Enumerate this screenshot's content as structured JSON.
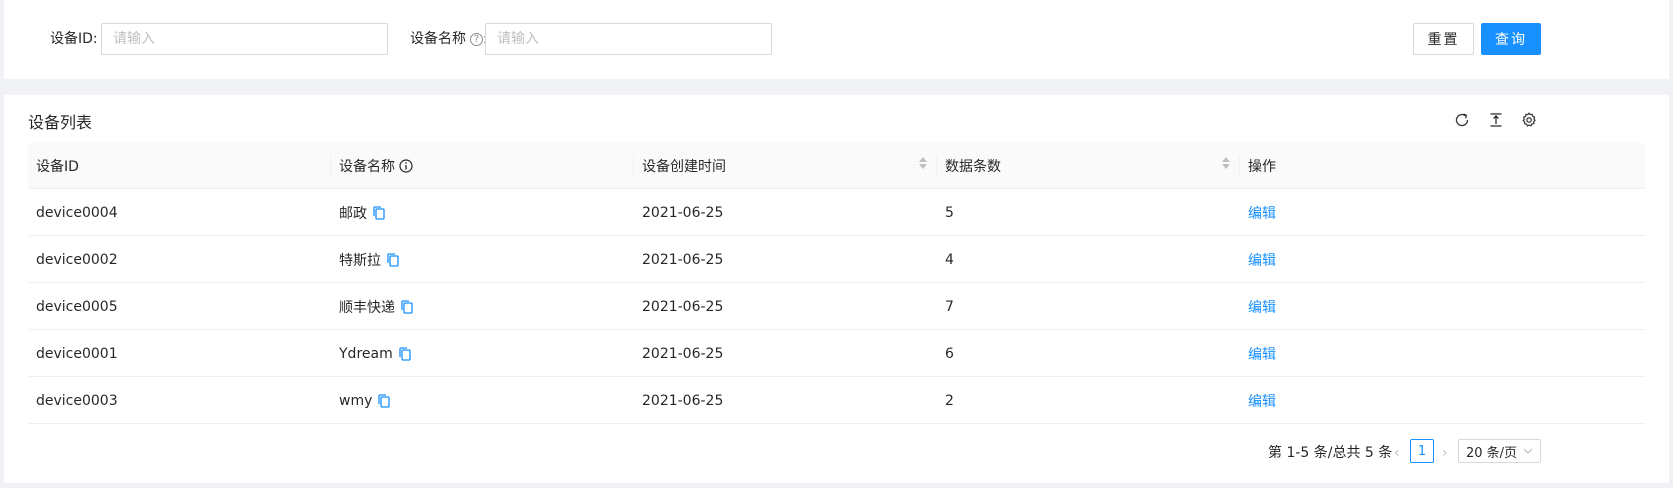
{
  "search": {
    "device_id_label": "设备ID:",
    "device_id_placeholder": "请输入",
    "device_name_label": "设备名称",
    "help_glyph": "?",
    "device_name_colon": ":",
    "device_name_placeholder": "请输入",
    "reset_label": "重置",
    "query_label": "查询"
  },
  "table": {
    "title": "设备列表",
    "columns": [
      "设备ID",
      "设备名称",
      "设备创建时间",
      "数据条数",
      "操作"
    ],
    "rows": [
      {
        "id": "device0004",
        "name": "邮政",
        "created": "2021-06-25",
        "count": "5",
        "action": "编辑"
      },
      {
        "id": "device0002",
        "name": "特斯拉",
        "created": "2021-06-25",
        "count": "4",
        "action": "编辑"
      },
      {
        "id": "device0005",
        "name": "顺丰快递",
        "created": "2021-06-25",
        "count": "7",
        "action": "编辑"
      },
      {
        "id": "device0001",
        "name": "Ydream",
        "created": "2021-06-25",
        "count": "6",
        "action": "编辑"
      },
      {
        "id": "device0003",
        "name": "wmy",
        "created": "2021-06-25",
        "count": "2",
        "action": "编辑"
      }
    ]
  },
  "pagination": {
    "total_text": "第 1-5 条/总共 5 条",
    "current_page": "1",
    "page_size": "20 条/页",
    "prev_glyph": "‹",
    "next_glyph": "›"
  },
  "colors": {
    "primary": "#1890ff",
    "background": "#f0f2f5"
  }
}
